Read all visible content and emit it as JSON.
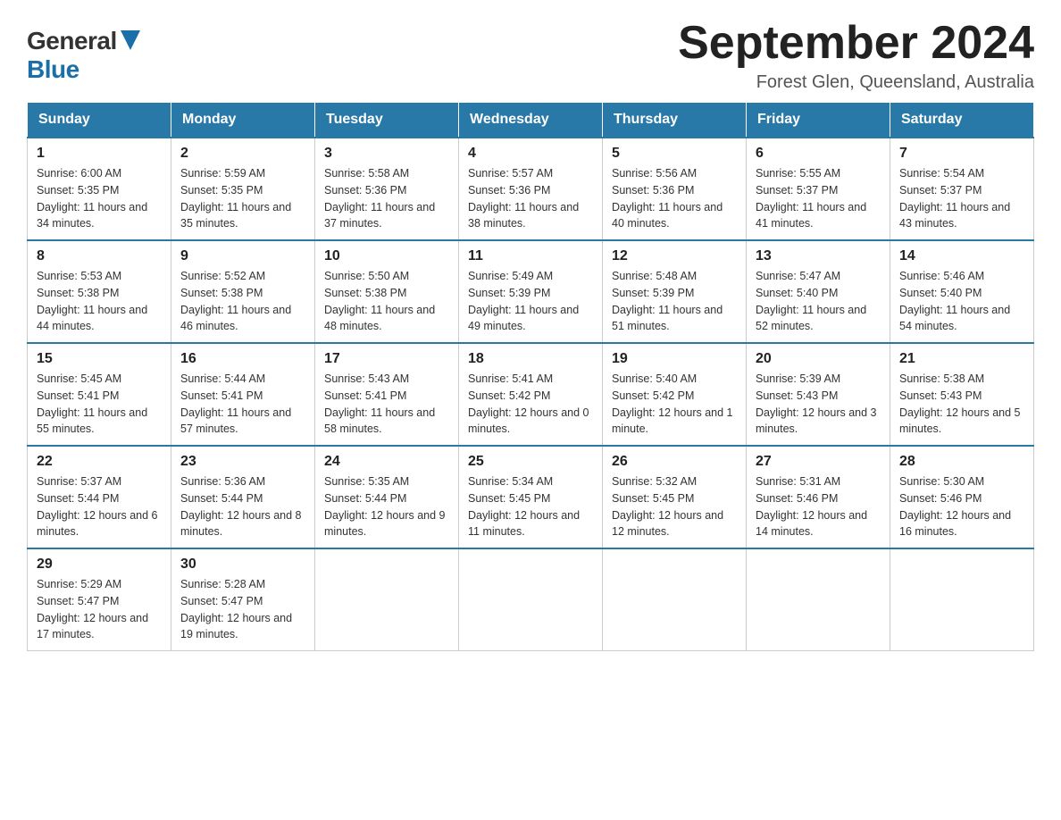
{
  "header": {
    "logo_general": "General",
    "logo_blue": "Blue",
    "month_year": "September 2024",
    "location": "Forest Glen, Queensland, Australia"
  },
  "days_of_week": [
    "Sunday",
    "Monday",
    "Tuesday",
    "Wednesday",
    "Thursday",
    "Friday",
    "Saturday"
  ],
  "weeks": [
    [
      {
        "day": "1",
        "sunrise": "6:00 AM",
        "sunset": "5:35 PM",
        "daylight": "11 hours and 34 minutes."
      },
      {
        "day": "2",
        "sunrise": "5:59 AM",
        "sunset": "5:35 PM",
        "daylight": "11 hours and 35 minutes."
      },
      {
        "day": "3",
        "sunrise": "5:58 AM",
        "sunset": "5:36 PM",
        "daylight": "11 hours and 37 minutes."
      },
      {
        "day": "4",
        "sunrise": "5:57 AM",
        "sunset": "5:36 PM",
        "daylight": "11 hours and 38 minutes."
      },
      {
        "day": "5",
        "sunrise": "5:56 AM",
        "sunset": "5:36 PM",
        "daylight": "11 hours and 40 minutes."
      },
      {
        "day": "6",
        "sunrise": "5:55 AM",
        "sunset": "5:37 PM",
        "daylight": "11 hours and 41 minutes."
      },
      {
        "day": "7",
        "sunrise": "5:54 AM",
        "sunset": "5:37 PM",
        "daylight": "11 hours and 43 minutes."
      }
    ],
    [
      {
        "day": "8",
        "sunrise": "5:53 AM",
        "sunset": "5:38 PM",
        "daylight": "11 hours and 44 minutes."
      },
      {
        "day": "9",
        "sunrise": "5:52 AM",
        "sunset": "5:38 PM",
        "daylight": "11 hours and 46 minutes."
      },
      {
        "day": "10",
        "sunrise": "5:50 AM",
        "sunset": "5:38 PM",
        "daylight": "11 hours and 48 minutes."
      },
      {
        "day": "11",
        "sunrise": "5:49 AM",
        "sunset": "5:39 PM",
        "daylight": "11 hours and 49 minutes."
      },
      {
        "day": "12",
        "sunrise": "5:48 AM",
        "sunset": "5:39 PM",
        "daylight": "11 hours and 51 minutes."
      },
      {
        "day": "13",
        "sunrise": "5:47 AM",
        "sunset": "5:40 PM",
        "daylight": "11 hours and 52 minutes."
      },
      {
        "day": "14",
        "sunrise": "5:46 AM",
        "sunset": "5:40 PM",
        "daylight": "11 hours and 54 minutes."
      }
    ],
    [
      {
        "day": "15",
        "sunrise": "5:45 AM",
        "sunset": "5:41 PM",
        "daylight": "11 hours and 55 minutes."
      },
      {
        "day": "16",
        "sunrise": "5:44 AM",
        "sunset": "5:41 PM",
        "daylight": "11 hours and 57 minutes."
      },
      {
        "day": "17",
        "sunrise": "5:43 AM",
        "sunset": "5:41 PM",
        "daylight": "11 hours and 58 minutes."
      },
      {
        "day": "18",
        "sunrise": "5:41 AM",
        "sunset": "5:42 PM",
        "daylight": "12 hours and 0 minutes."
      },
      {
        "day": "19",
        "sunrise": "5:40 AM",
        "sunset": "5:42 PM",
        "daylight": "12 hours and 1 minute."
      },
      {
        "day": "20",
        "sunrise": "5:39 AM",
        "sunset": "5:43 PM",
        "daylight": "12 hours and 3 minutes."
      },
      {
        "day": "21",
        "sunrise": "5:38 AM",
        "sunset": "5:43 PM",
        "daylight": "12 hours and 5 minutes."
      }
    ],
    [
      {
        "day": "22",
        "sunrise": "5:37 AM",
        "sunset": "5:44 PM",
        "daylight": "12 hours and 6 minutes."
      },
      {
        "day": "23",
        "sunrise": "5:36 AM",
        "sunset": "5:44 PM",
        "daylight": "12 hours and 8 minutes."
      },
      {
        "day": "24",
        "sunrise": "5:35 AM",
        "sunset": "5:44 PM",
        "daylight": "12 hours and 9 minutes."
      },
      {
        "day": "25",
        "sunrise": "5:34 AM",
        "sunset": "5:45 PM",
        "daylight": "12 hours and 11 minutes."
      },
      {
        "day": "26",
        "sunrise": "5:32 AM",
        "sunset": "5:45 PM",
        "daylight": "12 hours and 12 minutes."
      },
      {
        "day": "27",
        "sunrise": "5:31 AM",
        "sunset": "5:46 PM",
        "daylight": "12 hours and 14 minutes."
      },
      {
        "day": "28",
        "sunrise": "5:30 AM",
        "sunset": "5:46 PM",
        "daylight": "12 hours and 16 minutes."
      }
    ],
    [
      {
        "day": "29",
        "sunrise": "5:29 AM",
        "sunset": "5:47 PM",
        "daylight": "12 hours and 17 minutes."
      },
      {
        "day": "30",
        "sunrise": "5:28 AM",
        "sunset": "5:47 PM",
        "daylight": "12 hours and 19 minutes."
      },
      null,
      null,
      null,
      null,
      null
    ]
  ]
}
